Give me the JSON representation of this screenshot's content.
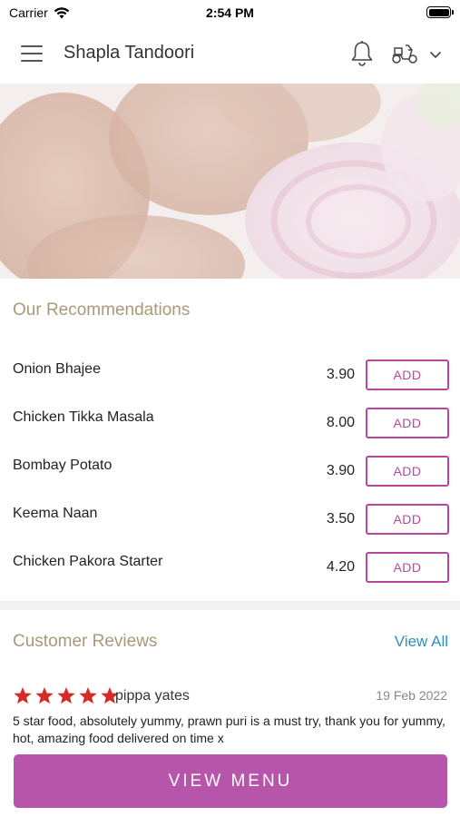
{
  "status_bar": {
    "carrier": "Carrier",
    "time": "2:54 PM"
  },
  "header": {
    "title": "Shapla Tandoori",
    "icons": [
      "menu-icon",
      "bell-icon",
      "scooter-icon",
      "chevron-down-icon"
    ]
  },
  "recommendations": {
    "title": "Our Recommendations",
    "add_label": "ADD",
    "items": [
      {
        "name": "Onion Bhajee",
        "price": "3.90"
      },
      {
        "name": "Chicken Tikka Masala",
        "price": "8.00"
      },
      {
        "name": "Bombay Potato",
        "price": "3.90"
      },
      {
        "name": "Keema Naan",
        "price": "3.50"
      },
      {
        "name": "Chicken Pakora Starter",
        "price": "4.20"
      }
    ]
  },
  "reviews": {
    "title": "Customer Reviews",
    "view_all": "View All",
    "items": [
      {
        "rating": 5,
        "reviewer": "pippa yates",
        "date": "19 Feb 2022",
        "text": "5 star food, absolutely yummy, prawn puri is a must try, thank you for yummy, hot, amazing food delivered on time x"
      }
    ]
  },
  "footer": {
    "view_menu": "VIEW MENU"
  },
  "colors": {
    "accent": "#b7489e",
    "view_menu_bg": "#b755ab",
    "section_title": "#a89a78",
    "link": "#2f8ec2",
    "star": "#d32a2a"
  }
}
